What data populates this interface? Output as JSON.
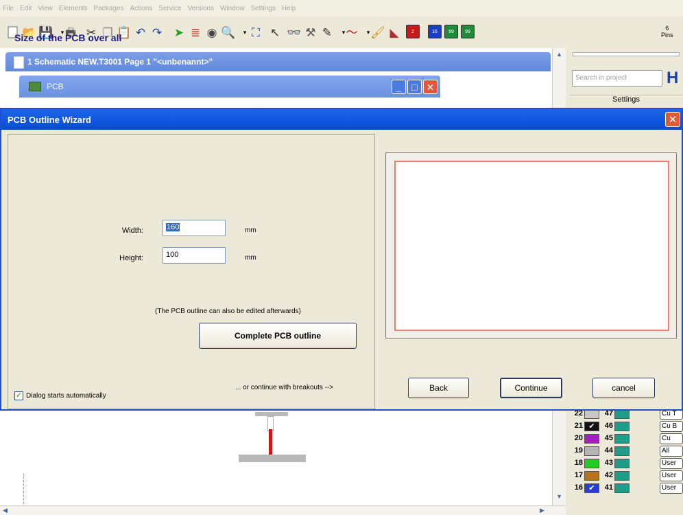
{
  "menu": [
    "File",
    "Edit",
    "View",
    "Elements",
    "Packages",
    "Actions",
    "Service",
    "Versions",
    "Window",
    "Settings",
    "Help"
  ],
  "toolbar": {
    "pins_count": "6",
    "pins_label": "Pins",
    "layer_buttons": [
      "2",
      "16",
      "99",
      "99"
    ]
  },
  "schematic_window": {
    "title": "1 Schematic NEW.T3001 Page 1 \"<unbenannt>\""
  },
  "pcb_window": {
    "title": "PCB"
  },
  "right_panel": {
    "search_placeholder": "Search in project",
    "settings_label": "Settings",
    "layers": [
      {
        "left": "22",
        "left_color": "#c8c8c8",
        "right": "47",
        "button": "Cu T"
      },
      {
        "left": "21",
        "left_color": "#111111",
        "left_check": "✔",
        "right": "46",
        "button": "Cu B"
      },
      {
        "left": "20",
        "left_color": "#a020c0",
        "right": "45",
        "button": "Cu"
      },
      {
        "left": "19",
        "left_color": "#b4b4b4",
        "right": "44",
        "button": "All"
      },
      {
        "left": "18",
        "left_color": "#22cc22",
        "right": "43",
        "button": "User"
      },
      {
        "left": "17",
        "left_color": "#b8741a",
        "right": "42",
        "button": "User"
      },
      {
        "left": "16",
        "left_color": "#2a3ed0",
        "left_check": "✔",
        "right": "41",
        "button": "User"
      }
    ]
  },
  "dialog": {
    "title": "PCB Outline Wizard",
    "heading": "Size of the PCB over all",
    "width_label": "Width:",
    "width_value": "160",
    "width_unit": "mm",
    "height_label": "Height:",
    "height_value": "100",
    "height_unit": "mm",
    "note": "(The PCB outline can also be edited afterwards)",
    "complete_button": "Complete PCB outline",
    "breakouts_hint": "... or continue with breakouts -->",
    "auto_start_label": "Dialog starts automatically",
    "auto_start_checked": true,
    "back_button": "Back",
    "continue_button": "Continue",
    "cancel_button": "cancel"
  }
}
